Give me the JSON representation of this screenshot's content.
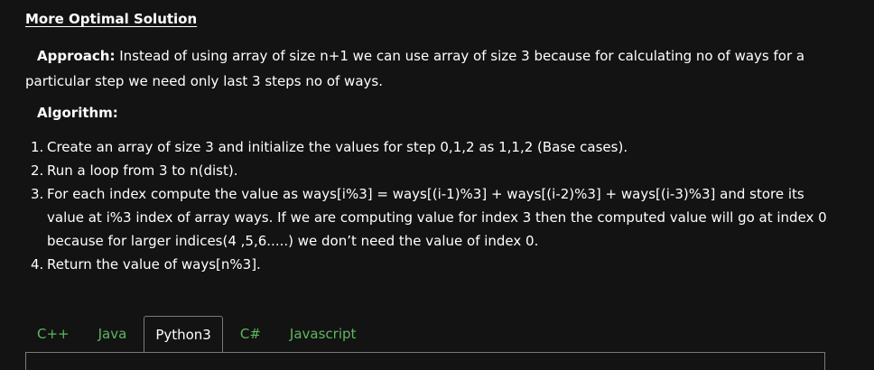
{
  "section": {
    "heading": "More Optimal Solution"
  },
  "approach": {
    "label": "Approach:",
    "text": " Instead of using array of size n+1 we can use array of size 3 because for calculating no of ways for a particular step we need only last    3 steps no of ways."
  },
  "algorithm": {
    "label": "Algorithm:",
    "steps": [
      {
        "num": "1.",
        "text": "Create an array of size 3 and initialize the values for step 0,1,2 as 1,1,2 (Base cases)."
      },
      {
        "num": "2.",
        "text": "Run a loop from 3 to n(dist)."
      },
      {
        "num": "3.",
        "text": "For each index compute the value as ways[i%3] = ways[(i-1)%3] + ways[(i-2)%3] + ways[(i-3)%3] and store its value at i%3 index of array ways. If we are computing value for index 3 then the computed value will go at index 0 because for larger indices(4 ,5,6.....) we don’t need the value of index 0."
      },
      {
        "num": "4.",
        "text": "Return the value of ways[n%3]."
      }
    ]
  },
  "tabs": [
    {
      "label": "C++",
      "active": false
    },
    {
      "label": "Java",
      "active": false
    },
    {
      "label": "Python3",
      "active": true
    },
    {
      "label": "C#",
      "active": false
    },
    {
      "label": "Javascript",
      "active": false
    }
  ],
  "colors": {
    "background": "#131313",
    "text": "#ffffff",
    "tab_inactive": "#5cb85c",
    "border": "#7a7a7a"
  }
}
